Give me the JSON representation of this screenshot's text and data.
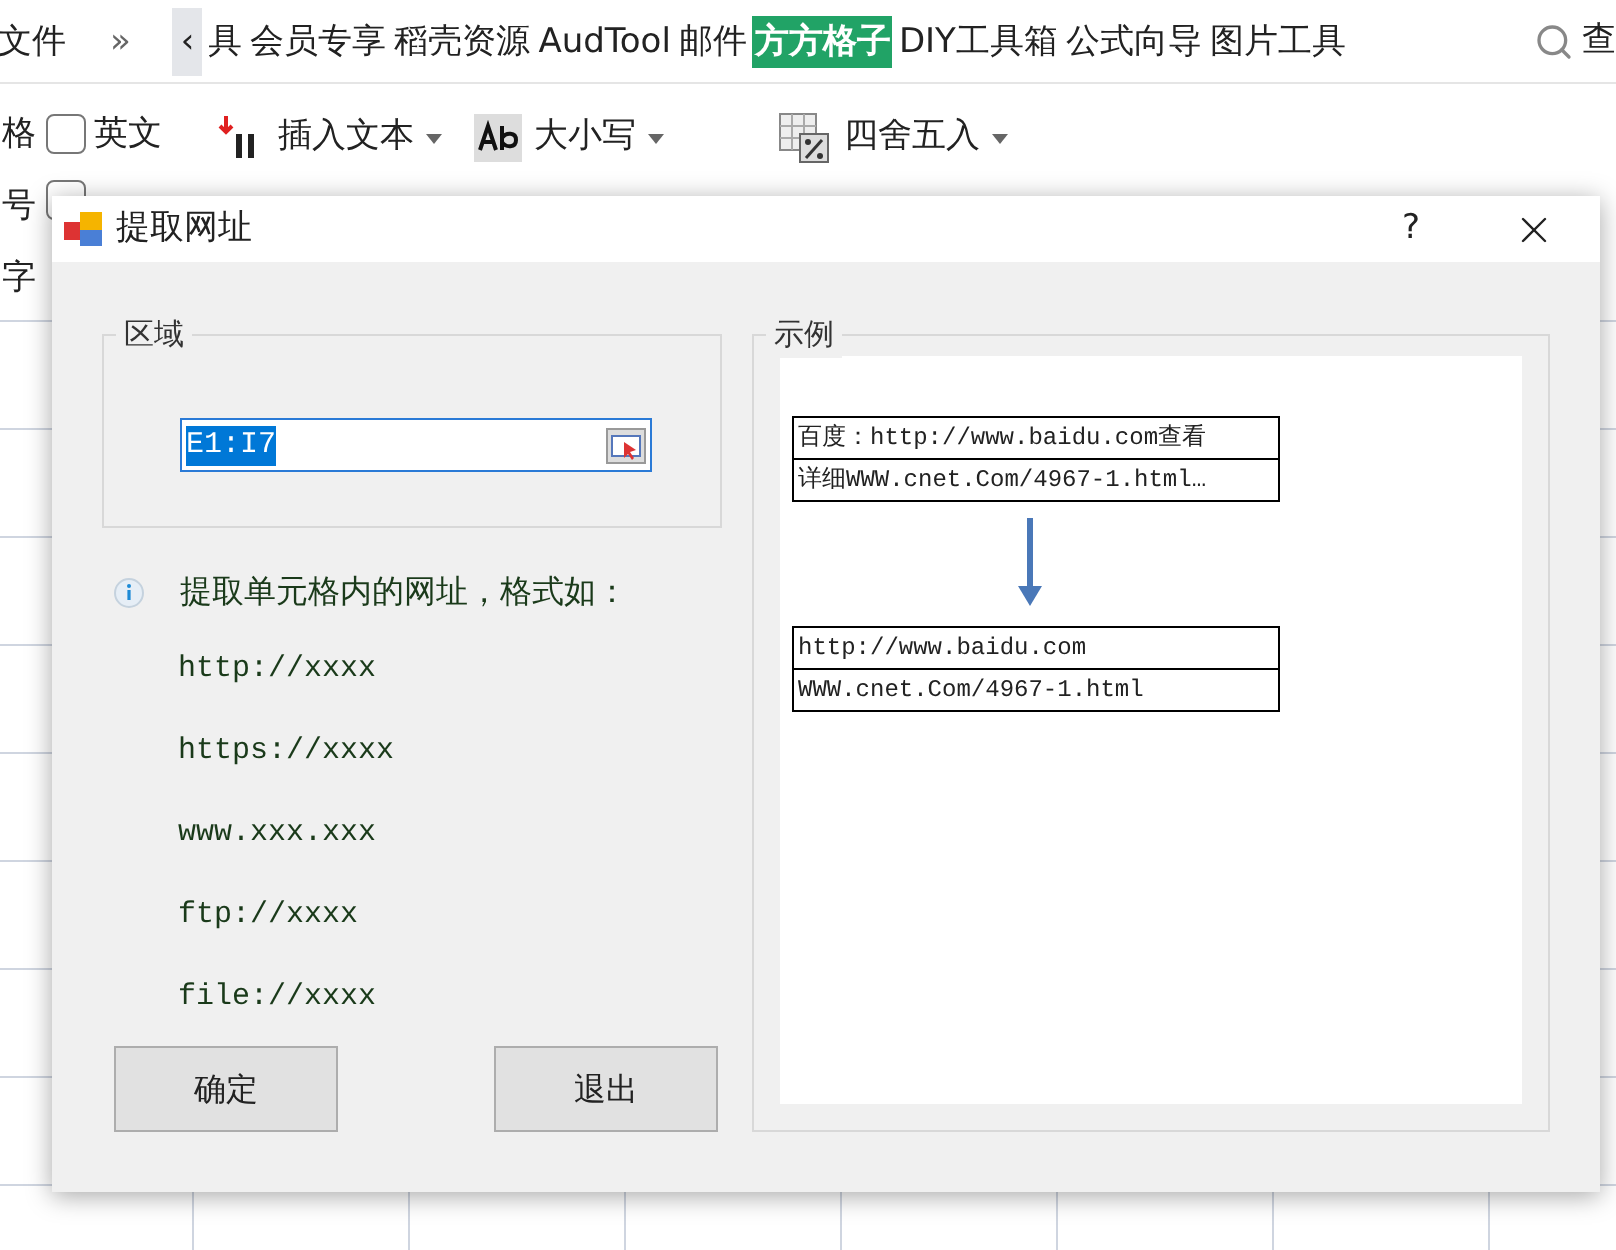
{
  "ribbon_tabs": [
    {
      "label": "文件",
      "selected": false
    },
    {
      "label": "»",
      "selected": false
    },
    {
      "label": "‹",
      "selected": false
    },
    {
      "label": "具",
      "selected": false
    },
    {
      "label": "会员专享",
      "selected": false
    },
    {
      "label": "稻壳资源",
      "selected": false
    },
    {
      "label": "AudTool",
      "selected": false
    },
    {
      "label": "邮件",
      "selected": false
    },
    {
      "label": "方方格子",
      "selected": true
    },
    {
      "label": "DIY工具箱",
      "selected": false
    },
    {
      "label": "公式向导",
      "selected": false
    },
    {
      "label": "图片工具",
      "selected": false
    }
  ],
  "search": {
    "label": "查"
  },
  "ribbon": {
    "side_labels": [
      "格",
      "号",
      "字"
    ],
    "checkbox": {
      "label": "英文",
      "checked": false
    },
    "checkbox_2": {
      "checked": false
    },
    "tools": [
      {
        "label": "插入文本",
        "kind": "insert"
      },
      {
        "label": "大小写",
        "kind": "case"
      },
      {
        "label": "四舍五入",
        "kind": "round"
      }
    ]
  },
  "dialog": {
    "title": "提取网址",
    "help": "?",
    "region": {
      "title": "区域",
      "value": "E1:I7"
    },
    "info": "提取单元格内的网址，格式如：",
    "formats": [
      "http://xxxx",
      "https://xxxx",
      "www.xxx.xxx",
      "ftp://xxxx",
      "file://xxxx"
    ],
    "buttons": [
      "确定",
      "退出"
    ],
    "example": {
      "title": "示例",
      "before": [
        "百度：http://www.baidu.com查看",
        "详细WWW.cnet.Com/4967-1.html…"
      ],
      "after": [
        "http://www.baidu.com",
        "WWW.cnet.Com/4967-1.html"
      ]
    }
  }
}
